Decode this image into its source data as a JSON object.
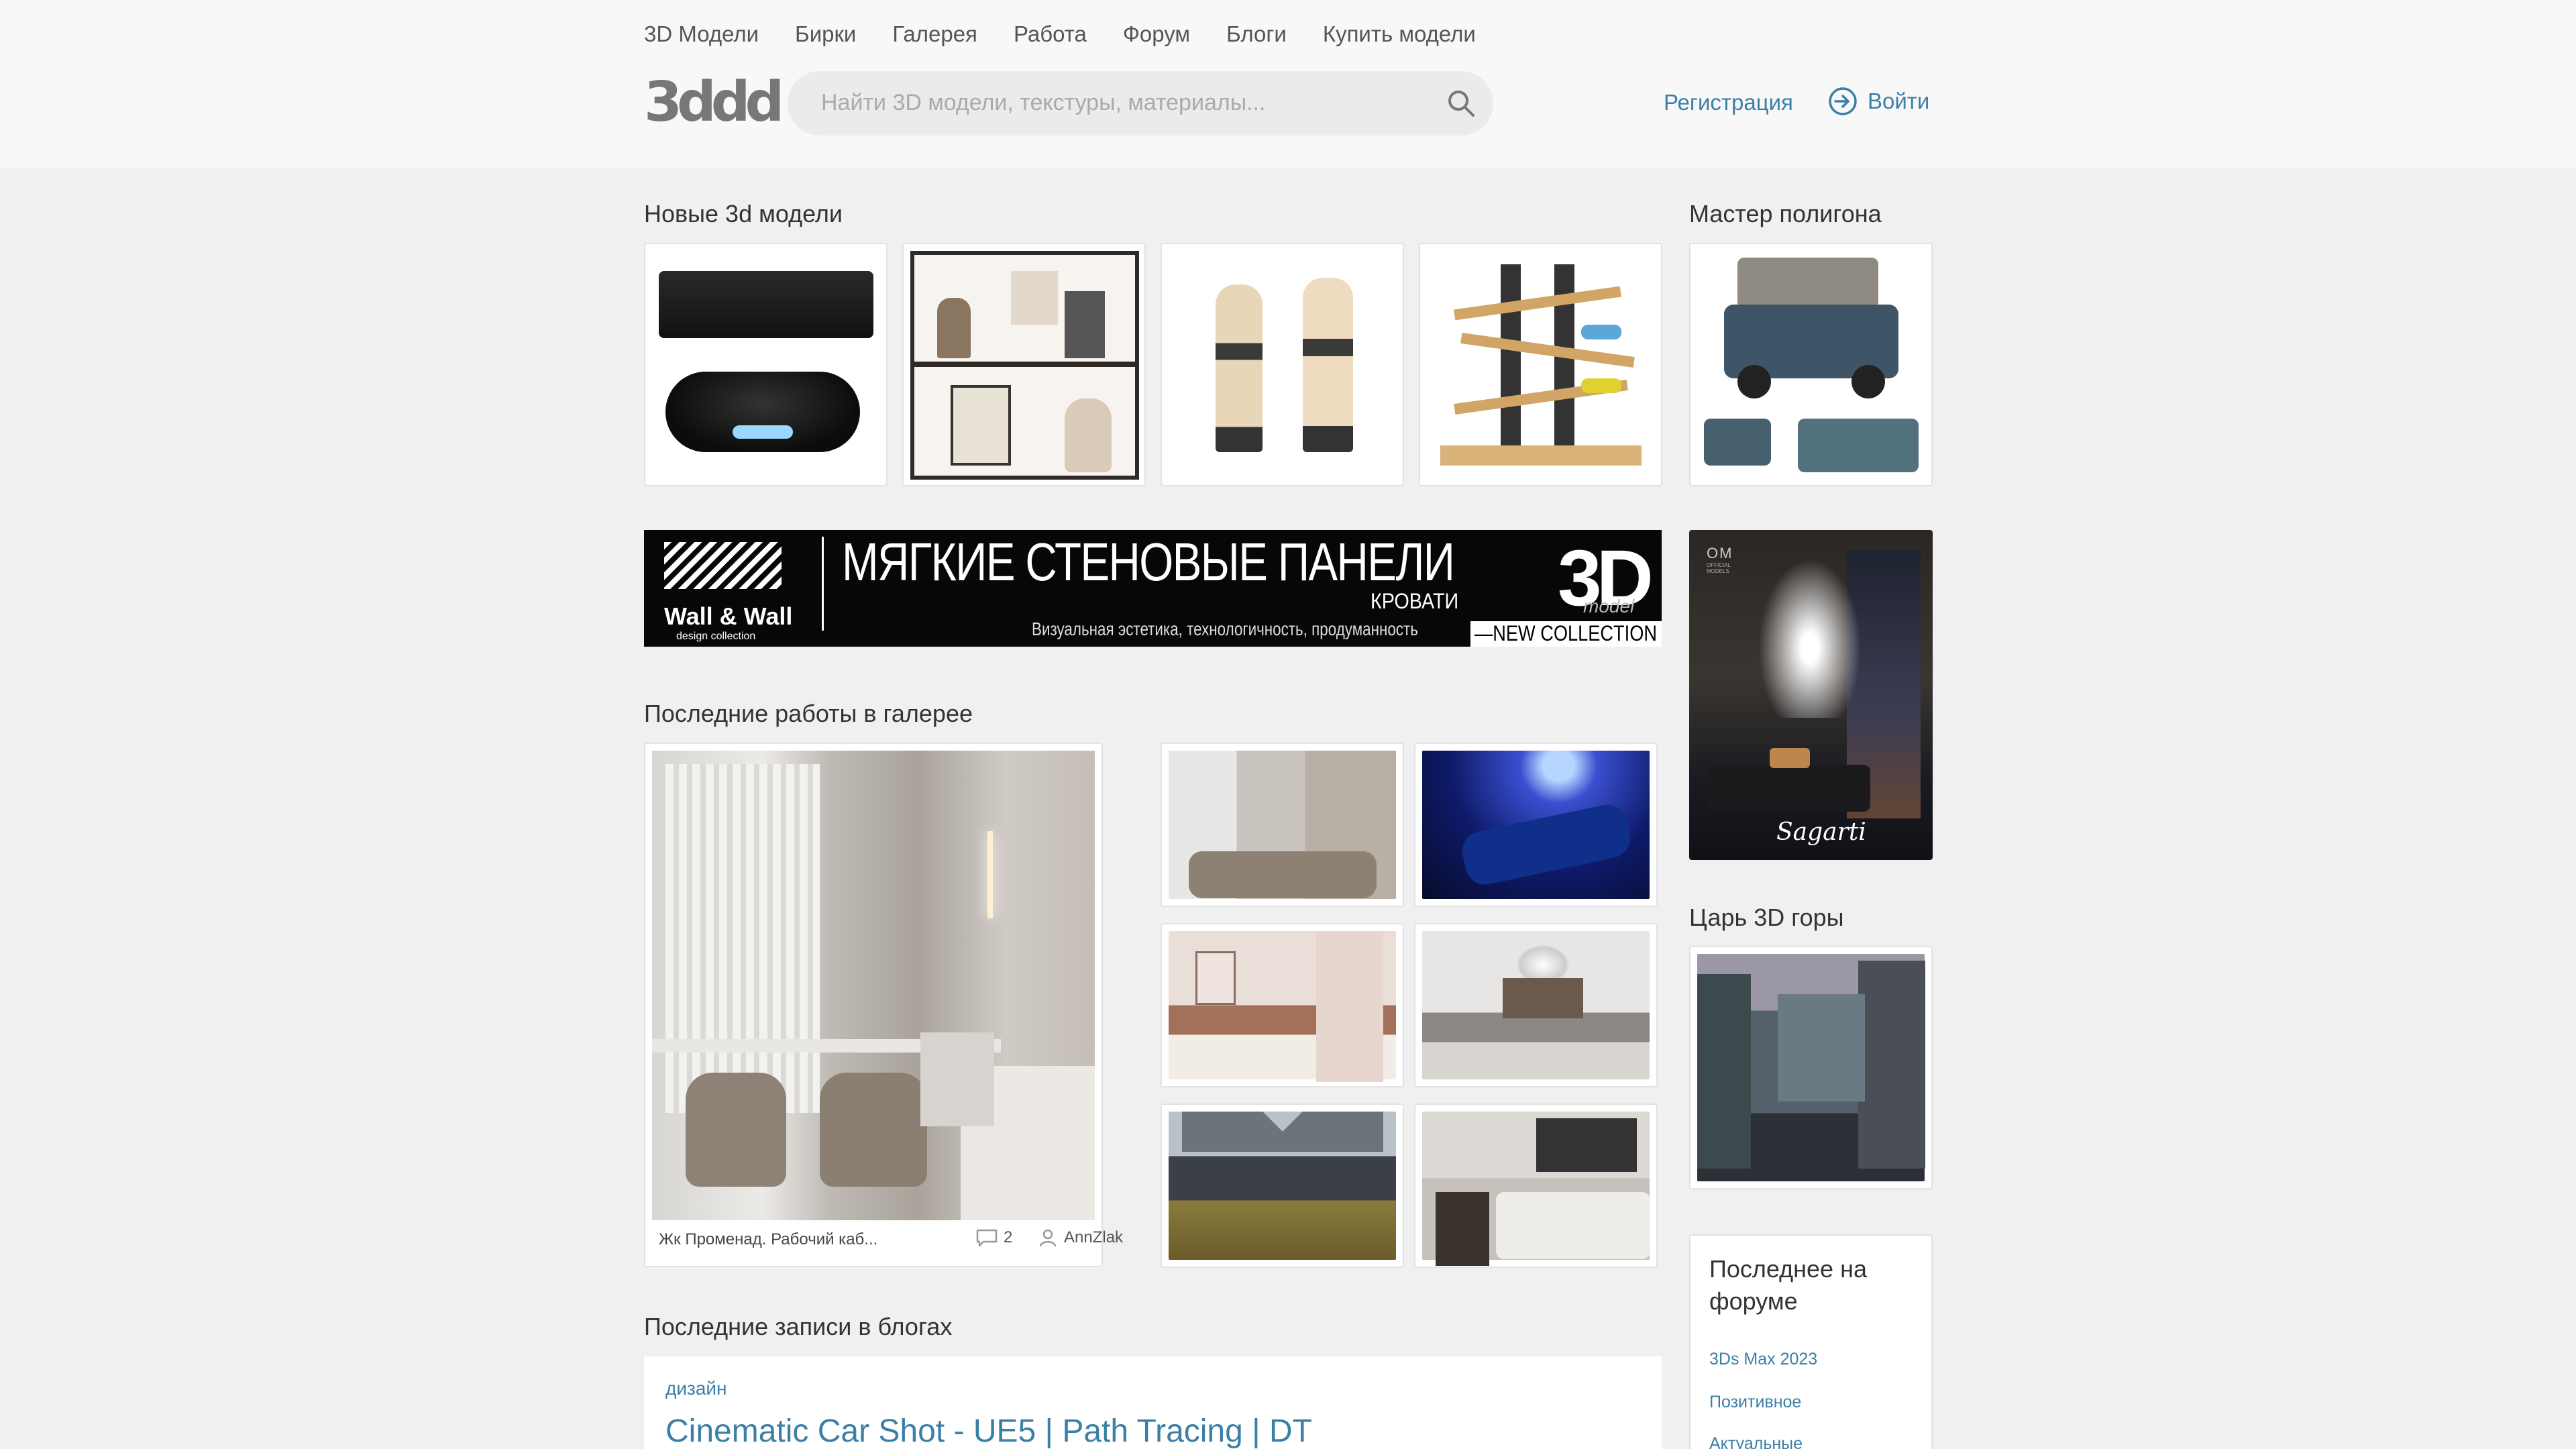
{
  "nav": {
    "menu": [
      "3D Модели",
      "Бирки",
      "Галерея",
      "Работа",
      "Форум",
      "Блоги",
      "Купить модели"
    ],
    "logo": "3ddd",
    "search_placeholder": "Найти 3D модели, текстуры, материалы...",
    "register": "Регистрация",
    "login": "Войти"
  },
  "new_models": {
    "title": "Новые 3d модели",
    "items": [
      {
        "alt": "PlayStation console with controllers"
      },
      {
        "alt": "Decorative shelf set"
      },
      {
        "alt": "Workers in overalls"
      },
      {
        "alt": "Wooden toy car ramp"
      }
    ]
  },
  "polygon_master": {
    "title": "Мастер полигона",
    "alt": "Off-road car with roof tent"
  },
  "banner": {
    "brand": "Wall & Wall",
    "brand_sub": "design collection",
    "headline": "МЯГКИЕ СТЕНОВЫЕ ПАНЕЛИ",
    "subline": "КРОВАТИ",
    "tagline": "Визуальная эстетика, технологичность, продуманность",
    "badge": "3D",
    "badge_sub": "model",
    "collection": "—NEW COLLECTION"
  },
  "side_ad": {
    "brand": "Sagarti",
    "mark": "OM",
    "mark_sub": "OFFICIAL MODELS"
  },
  "gallery": {
    "title": "Последние работы в галерее",
    "featured": {
      "caption": "Жк Променад. Рабочий каб...",
      "comments": "2",
      "author": "AnnZlak"
    }
  },
  "king": {
    "title": "Царь 3D горы"
  },
  "blogs": {
    "title": "Последние записи в блогах",
    "tag": "дизайн",
    "post_title": "Cinematic Car Shot - UE5 | Path Tracing | DT"
  },
  "forum": {
    "title": "Последнее на форуме",
    "links": [
      "3Ds Max 2023",
      "Позитивное",
      "Актуальные"
    ]
  }
}
